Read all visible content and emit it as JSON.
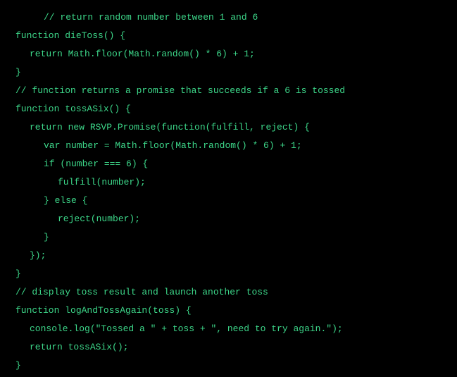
{
  "code": {
    "lines": [
      {
        "text": "// return random number between 1 and 6",
        "indent": 2
      },
      {
        "text": "function dieToss() {",
        "indent": 0
      },
      {
        "text": "return Math.floor(Math.random() * 6) + 1;",
        "indent": 1
      },
      {
        "text": "}",
        "indent": 0
      },
      {
        "text": "// function returns a promise that succeeds if a 6 is tossed",
        "indent": 0
      },
      {
        "text": "function tossASix() {",
        "indent": 0
      },
      {
        "text": "return new RSVP.Promise(function(fulfill, reject) {",
        "indent": 1
      },
      {
        "text": "var number = Math.floor(Math.random() * 6) + 1;",
        "indent": 2
      },
      {
        "text": "if (number === 6) {",
        "indent": 2
      },
      {
        "text": "fulfill(number);",
        "indent": 3
      },
      {
        "text": "} else {",
        "indent": 2
      },
      {
        "text": "reject(number);",
        "indent": 3
      },
      {
        "text": "}",
        "indent": 2
      },
      {
        "text": "});",
        "indent": 1
      },
      {
        "text": "}",
        "indent": 0
      },
      {
        "text": "// display toss result and launch another toss",
        "indent": 0
      },
      {
        "text": "function logAndTossAgain(toss) {",
        "indent": 0
      },
      {
        "text": "console.log(\"Tossed a \" + toss + \", need to try again.\");",
        "indent": 1
      },
      {
        "text": "return tossASix();",
        "indent": 1
      },
      {
        "text": "}",
        "indent": 0
      }
    ]
  }
}
